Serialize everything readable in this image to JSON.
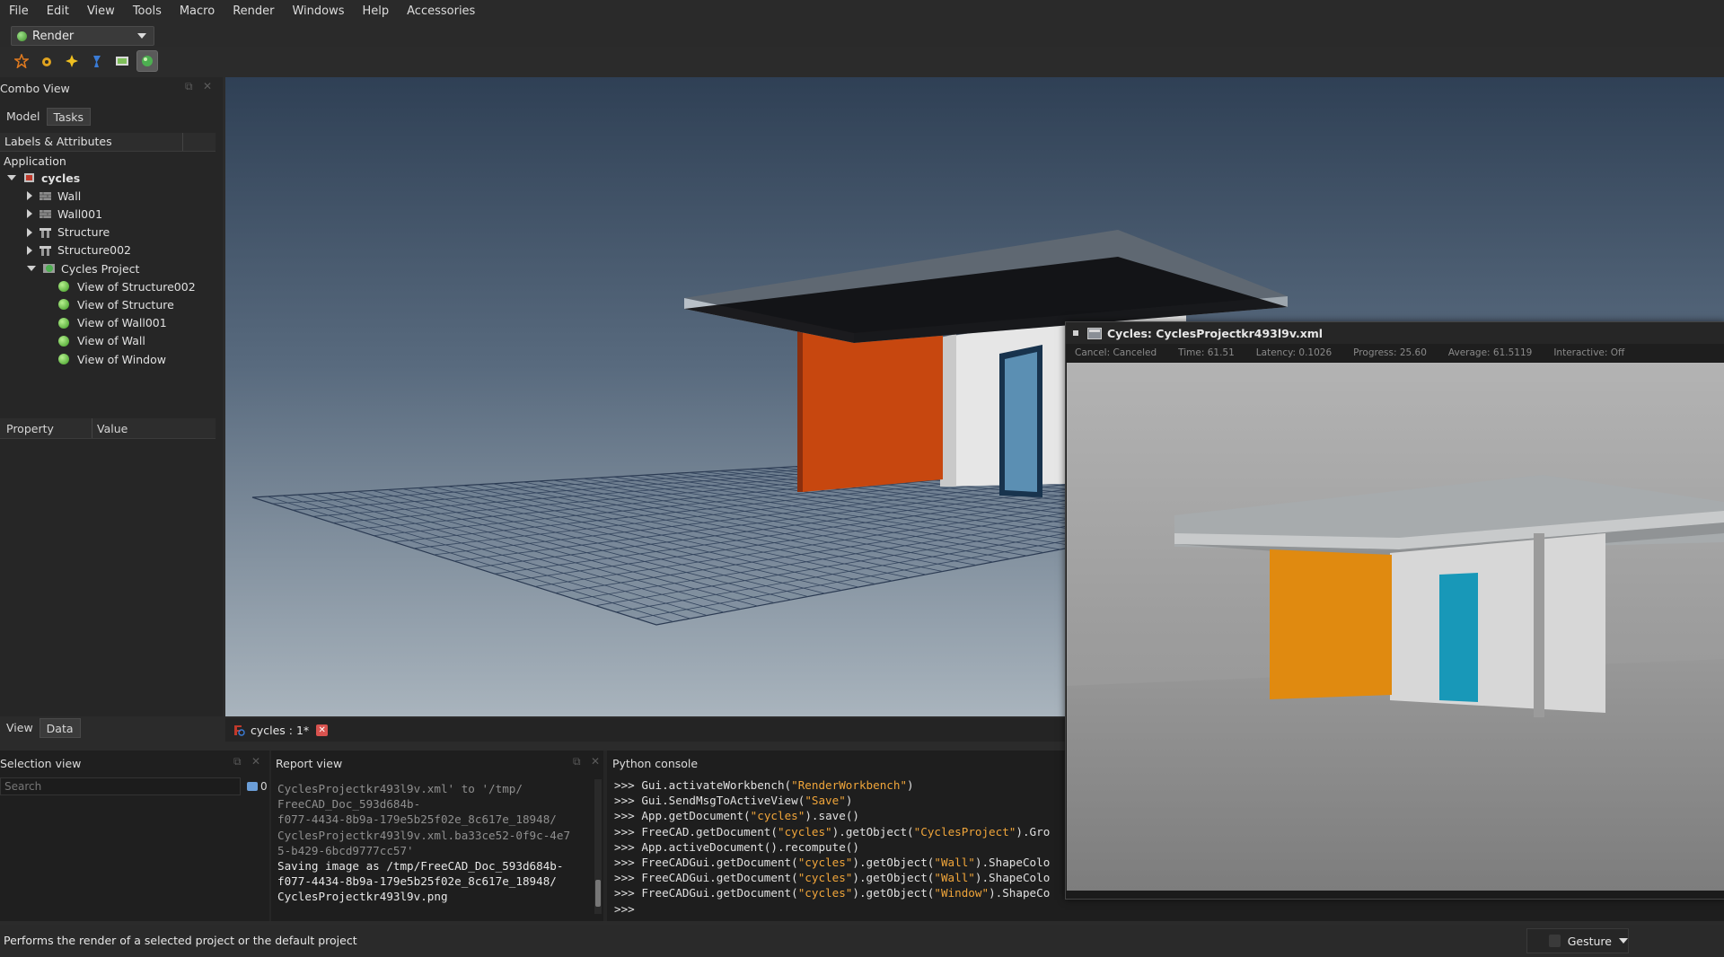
{
  "menu": [
    "File",
    "Edit",
    "View",
    "Tools",
    "Macro",
    "Render",
    "Windows",
    "Help",
    "Accessories"
  ],
  "workbench": {
    "selected": "Render"
  },
  "toolbar": {
    "icons": [
      "new-project-icon",
      "render-settings-icon",
      "add-view-icon",
      "lamp-icon",
      "render-image-icon",
      "render-project-icon"
    ],
    "active_index": 5
  },
  "combo": {
    "title": "Combo View",
    "tabs": [
      "Model",
      "Tasks"
    ],
    "selected_tab": "Tasks",
    "tree_header": "Labels & Attributes",
    "root_label": "Application",
    "document": "cycles",
    "items": [
      {
        "label": "Wall",
        "icon": "wall-icon"
      },
      {
        "label": "Wall001",
        "icon": "wall-icon"
      },
      {
        "label": "Structure",
        "icon": "structure-icon"
      },
      {
        "label": "Structure002",
        "icon": "structure-icon"
      },
      {
        "label": "Cycles Project",
        "icon": "project-icon"
      }
    ],
    "project_children": [
      "View of Structure002",
      "View of Structure",
      "View of Wall001",
      "View of Wall",
      "View of Window"
    ],
    "property_header": "Property",
    "value_header": "Value",
    "bottom_tabs": [
      "View",
      "Data"
    ],
    "selected_bottom_tab": "Data"
  },
  "doc_tab": {
    "label": "cycles : 1*"
  },
  "selection": {
    "title": "Selection view",
    "search_placeholder": "Search",
    "count": "0"
  },
  "report": {
    "title": "Report view",
    "lines": [
      {
        "text": "CyclesProjectkr493l9v.xml' to '/tmp/",
        "hi": false
      },
      {
        "text": "FreeCAD_Doc_593d684b-",
        "hi": false
      },
      {
        "text": "f077-4434-8b9a-179e5b25f02e_8c617e_18948/",
        "hi": false
      },
      {
        "text": "CyclesProjectkr493l9v.xml.ba33ce52-0f9c-4e7",
        "hi": false
      },
      {
        "text": "5-b429-6bcd9777cc57'",
        "hi": false
      },
      {
        "text": "Saving image as /tmp/FreeCAD_Doc_593d684b-",
        "hi": true
      },
      {
        "text": "f077-4434-8b9a-179e5b25f02e_8c617e_18948/",
        "hi": true
      },
      {
        "text": "CyclesProjectkr493l9v.png",
        "hi": true
      }
    ]
  },
  "python": {
    "title": "Python console",
    "lines": [
      [
        ">>> Gui.activateWorkbench(",
        "\"RenderWorkbench\"",
        ")"
      ],
      [
        ">>> Gui.SendMsgToActiveView(",
        "\"Save\"",
        ")"
      ],
      [
        ">>> App.getDocument(",
        "\"cycles\"",
        ").save()"
      ],
      [
        ">>> FreeCAD.getDocument(",
        "\"cycles\"",
        ").getObject(",
        "\"CyclesProject\"",
        ").Gro"
      ],
      [
        ">>> App.activeDocument().recompute()"
      ],
      [
        ">>> FreeCADGui.getDocument(",
        "\"cycles\"",
        ").getObject(",
        "\"Wall\"",
        ").ShapeColo"
      ],
      [
        ">>> FreeCADGui.getDocument(",
        "\"cycles\"",
        ").getObject(",
        "\"Wall\"",
        ").ShapeColo"
      ],
      [
        ">>> FreeCADGui.getDocument(",
        "\"cycles\"",
        ").getObject(",
        "\"Window\"",
        ").ShapeCo"
      ],
      [
        ">>>"
      ]
    ]
  },
  "status": {
    "message": "Performs the render of a selected project or the default project",
    "navigation": "Gesture"
  },
  "render_window": {
    "title": "Cycles: CyclesProjectkr493l9v.xml",
    "stats": {
      "cancel": "Cancel: Canceled",
      "time": "Time: 61.51",
      "latency": "Latency: 0.1026",
      "progress": "Progress: 25.60",
      "average": "Average: 61.5119",
      "interactive": "Interactive: Off"
    }
  },
  "colors": {
    "accent_green": "#3c9a22",
    "string_orange": "#f0a53a",
    "wall_orange": "#d0501a",
    "render_orange": "#e08a10",
    "render_cyan": "#1898b8"
  }
}
